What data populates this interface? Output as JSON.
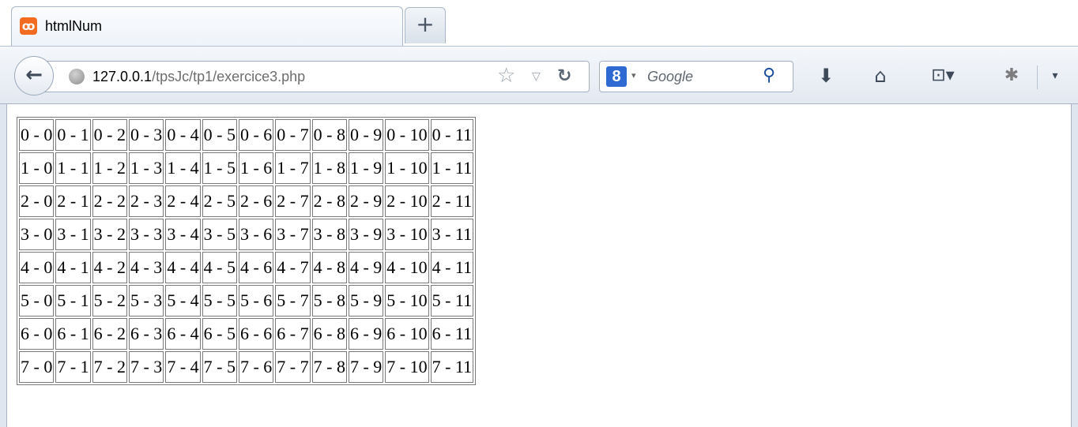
{
  "tab": {
    "title": "htmlNum",
    "favicon_glyph": "ꝏ"
  },
  "new_tab_label": "+",
  "url": {
    "host": "127.0.0.1",
    "path": "/tpsJc/tp1/exercice3.php"
  },
  "search": {
    "engine_glyph": "8",
    "placeholder": "Google"
  },
  "icons": {
    "back": "←",
    "star": "☆",
    "dropmarker": "▽",
    "reload": "↻",
    "engine_drop": "▾",
    "magnifier": "⚲",
    "download": "⬇",
    "home": "⌂",
    "bookmarks": "⊡▾",
    "addon": "✱",
    "menu_drop": "▾"
  },
  "table": {
    "rows": [
      [
        "0 - 0",
        "0 - 1",
        "0 - 2",
        "0 - 3",
        "0 - 4",
        "0 - 5",
        "0 - 6",
        "0 - 7",
        "0 - 8",
        "0 - 9",
        "0 - 10",
        "0 - 11"
      ],
      [
        "1 - 0",
        "1 - 1",
        "1 - 2",
        "1 - 3",
        "1 - 4",
        "1 - 5",
        "1 - 6",
        "1 - 7",
        "1 - 8",
        "1 - 9",
        "1 - 10",
        "1 - 11"
      ],
      [
        "2 - 0",
        "2 - 1",
        "2 - 2",
        "2 - 3",
        "2 - 4",
        "2 - 5",
        "2 - 6",
        "2 - 7",
        "2 - 8",
        "2 - 9",
        "2 - 10",
        "2 - 11"
      ],
      [
        "3 - 0",
        "3 - 1",
        "3 - 2",
        "3 - 3",
        "3 - 4",
        "3 - 5",
        "3 - 6",
        "3 - 7",
        "3 - 8",
        "3 - 9",
        "3 - 10",
        "3 - 11"
      ],
      [
        "4 - 0",
        "4 - 1",
        "4 - 2",
        "4 - 3",
        "4 - 4",
        "4 - 5",
        "4 - 6",
        "4 - 7",
        "4 - 8",
        "4 - 9",
        "4 - 10",
        "4 - 11"
      ],
      [
        "5 - 0",
        "5 - 1",
        "5 - 2",
        "5 - 3",
        "5 - 4",
        "5 - 5",
        "5 - 6",
        "5 - 7",
        "5 - 8",
        "5 - 9",
        "5 - 10",
        "5 - 11"
      ],
      [
        "6 - 0",
        "6 - 1",
        "6 - 2",
        "6 - 3",
        "6 - 4",
        "6 - 5",
        "6 - 6",
        "6 - 7",
        "6 - 8",
        "6 - 9",
        "6 - 10",
        "6 - 11"
      ],
      [
        "7 - 0",
        "7 - 1",
        "7 - 2",
        "7 - 3",
        "7 - 4",
        "7 - 5",
        "7 - 6",
        "7 - 7",
        "7 - 8",
        "7 - 9",
        "7 - 10",
        "7 - 11"
      ]
    ]
  }
}
